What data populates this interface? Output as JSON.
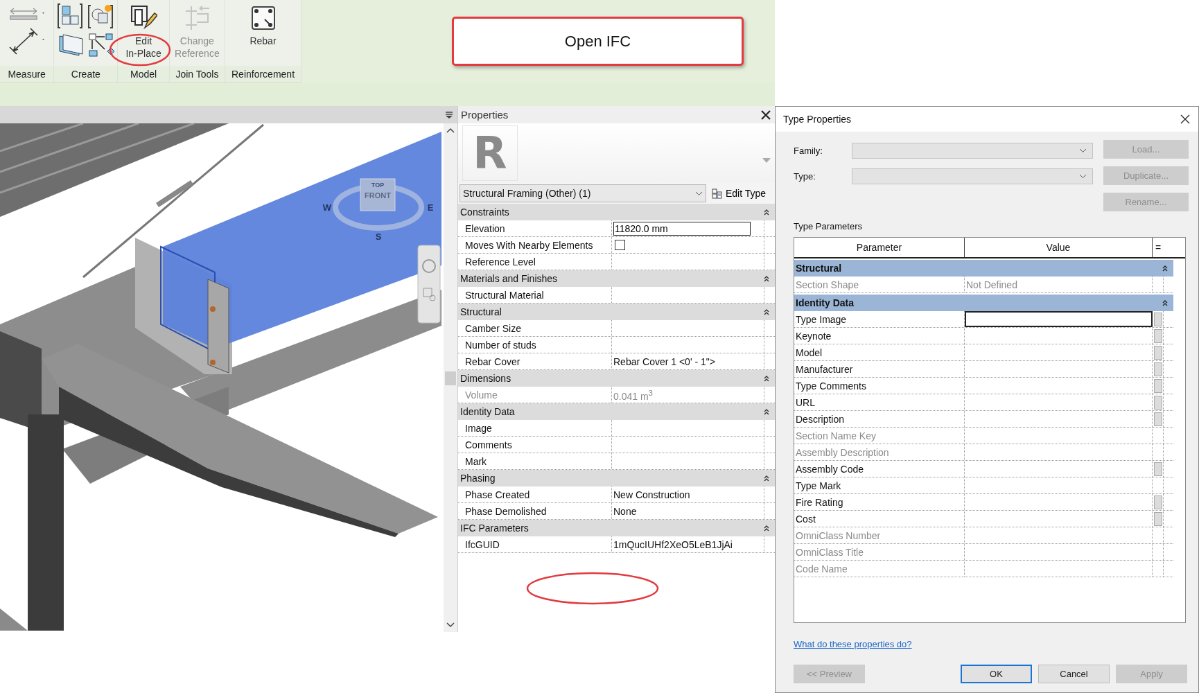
{
  "ribbon": {
    "groups": [
      {
        "label": "Measure"
      },
      {
        "label": "Create"
      },
      {
        "label": "Model",
        "tools": [
          {
            "label": "Edit\nIn-Place",
            "disabled": false
          }
        ]
      },
      {
        "label": "Join Tools",
        "tools": [
          {
            "label": "Change\nReference",
            "disabled": true
          }
        ]
      },
      {
        "label": "Reinforcement",
        "tools": [
          {
            "label": "Rebar",
            "disabled": false
          }
        ]
      }
    ]
  },
  "callout": {
    "text": "Open IFC"
  },
  "viewport": {
    "view_cube": {
      "face": "FRONT",
      "top": "TOP",
      "west": "W",
      "east": "E",
      "south": "S"
    }
  },
  "properties": {
    "title": "Properties",
    "preview_glyph": "R",
    "type_selector": "Structural Framing (Other) (1)",
    "edit_type": "Edit Type",
    "groups": [
      {
        "name": "Constraints",
        "rows": [
          {
            "label": "Elevation",
            "value": "11820.0 mm",
            "kind": "edit",
            "disabled": false
          },
          {
            "label": "Moves With Nearby Elements",
            "kind": "checkbox",
            "checked": false,
            "disabled": false
          },
          {
            "label": "Reference Level",
            "kind": "text",
            "disabled": false
          }
        ]
      },
      {
        "name": "Materials and Finishes",
        "rows": [
          {
            "label": "Structural Material",
            "kind": "text",
            "disabled": false
          }
        ]
      },
      {
        "name": "Structural",
        "rows": [
          {
            "label": "Camber Size",
            "kind": "text",
            "disabled": false
          },
          {
            "label": "Number of studs",
            "kind": "text",
            "disabled": false
          },
          {
            "label": "Rebar Cover",
            "value": "Rebar Cover 1 <0' - 1\">",
            "kind": "text",
            "disabled": false
          }
        ]
      },
      {
        "name": "Dimensions",
        "rows": [
          {
            "label": "Volume",
            "value": "0.041 m$^{3}$",
            "kind": "text",
            "disabled": true
          }
        ]
      },
      {
        "name": "Identity Data",
        "rows": [
          {
            "label": "Image",
            "kind": "text",
            "disabled": false
          },
          {
            "label": "Comments",
            "kind": "text",
            "disabled": false
          },
          {
            "label": "Mark",
            "kind": "text",
            "disabled": false
          }
        ]
      },
      {
        "name": "Phasing",
        "rows": [
          {
            "label": "Phase Created",
            "value": "New Construction",
            "kind": "text",
            "disabled": false
          },
          {
            "label": "Phase Demolished",
            "value": "None",
            "kind": "text",
            "disabled": false
          }
        ]
      },
      {
        "name": "IFC Parameters",
        "rows": [
          {
            "label": "IfcGUID",
            "value": "1mQucIUHf2XeO5LeB1JjAi",
            "kind": "text",
            "disabled": false
          }
        ]
      }
    ]
  },
  "type_properties": {
    "title": "Type Properties",
    "family_label": "Family:",
    "type_label": "Type:",
    "side_buttons": [
      {
        "label": "Load...",
        "disabled": true
      },
      {
        "label": "Duplicate...",
        "disabled": true
      },
      {
        "label": "Rename...",
        "disabled": true
      }
    ],
    "section_label": "Type Parameters",
    "columns": [
      "Parameter",
      "Value"
    ],
    "column_3": "=",
    "groups": [
      {
        "name": "Structural",
        "rows": [
          {
            "label": "Section Shape",
            "value": "Not Defined",
            "disabled": true,
            "button": false,
            "selected": false
          }
        ]
      },
      {
        "name": "Identity Data",
        "rows": [
          {
            "label": "Type Image",
            "disabled": false,
            "button": true,
            "selected": true
          },
          {
            "label": "Keynote",
            "disabled": false,
            "button": true,
            "selected": false
          },
          {
            "label": "Model",
            "disabled": false,
            "button": true,
            "selected": false
          },
          {
            "label": "Manufacturer",
            "disabled": false,
            "button": true,
            "selected": false
          },
          {
            "label": "Type Comments",
            "disabled": false,
            "button": true,
            "selected": false
          },
          {
            "label": "URL",
            "disabled": false,
            "button": true,
            "selected": false
          },
          {
            "label": "Description",
            "disabled": false,
            "button": true,
            "selected": false
          },
          {
            "label": "Section Name Key",
            "disabled": true,
            "button": false,
            "selected": false
          },
          {
            "label": "Assembly Description",
            "disabled": true,
            "button": false,
            "selected": false
          },
          {
            "label": "Assembly Code",
            "disabled": false,
            "button": true,
            "selected": false
          },
          {
            "label": "Type Mark",
            "disabled": false,
            "button": false,
            "selected": false
          },
          {
            "label": "Fire Rating",
            "disabled": false,
            "button": true,
            "selected": false
          },
          {
            "label": "Cost",
            "disabled": false,
            "button": true,
            "selected": false
          },
          {
            "label": "OmniClass Number",
            "disabled": true,
            "button": false,
            "selected": false
          },
          {
            "label": "OmniClass Title",
            "disabled": true,
            "button": false,
            "selected": false
          },
          {
            "label": "Code Name",
            "disabled": true,
            "button": false,
            "selected": false
          }
        ]
      }
    ],
    "help_link": "What do these properties do?",
    "footer_buttons": [
      {
        "label": "<< Preview",
        "disabled": true,
        "default": false
      },
      {
        "label": "OK",
        "disabled": false,
        "default": true
      },
      {
        "label": "Cancel",
        "disabled": false,
        "default": false
      },
      {
        "label": "Apply",
        "disabled": true,
        "default": false
      }
    ]
  }
}
